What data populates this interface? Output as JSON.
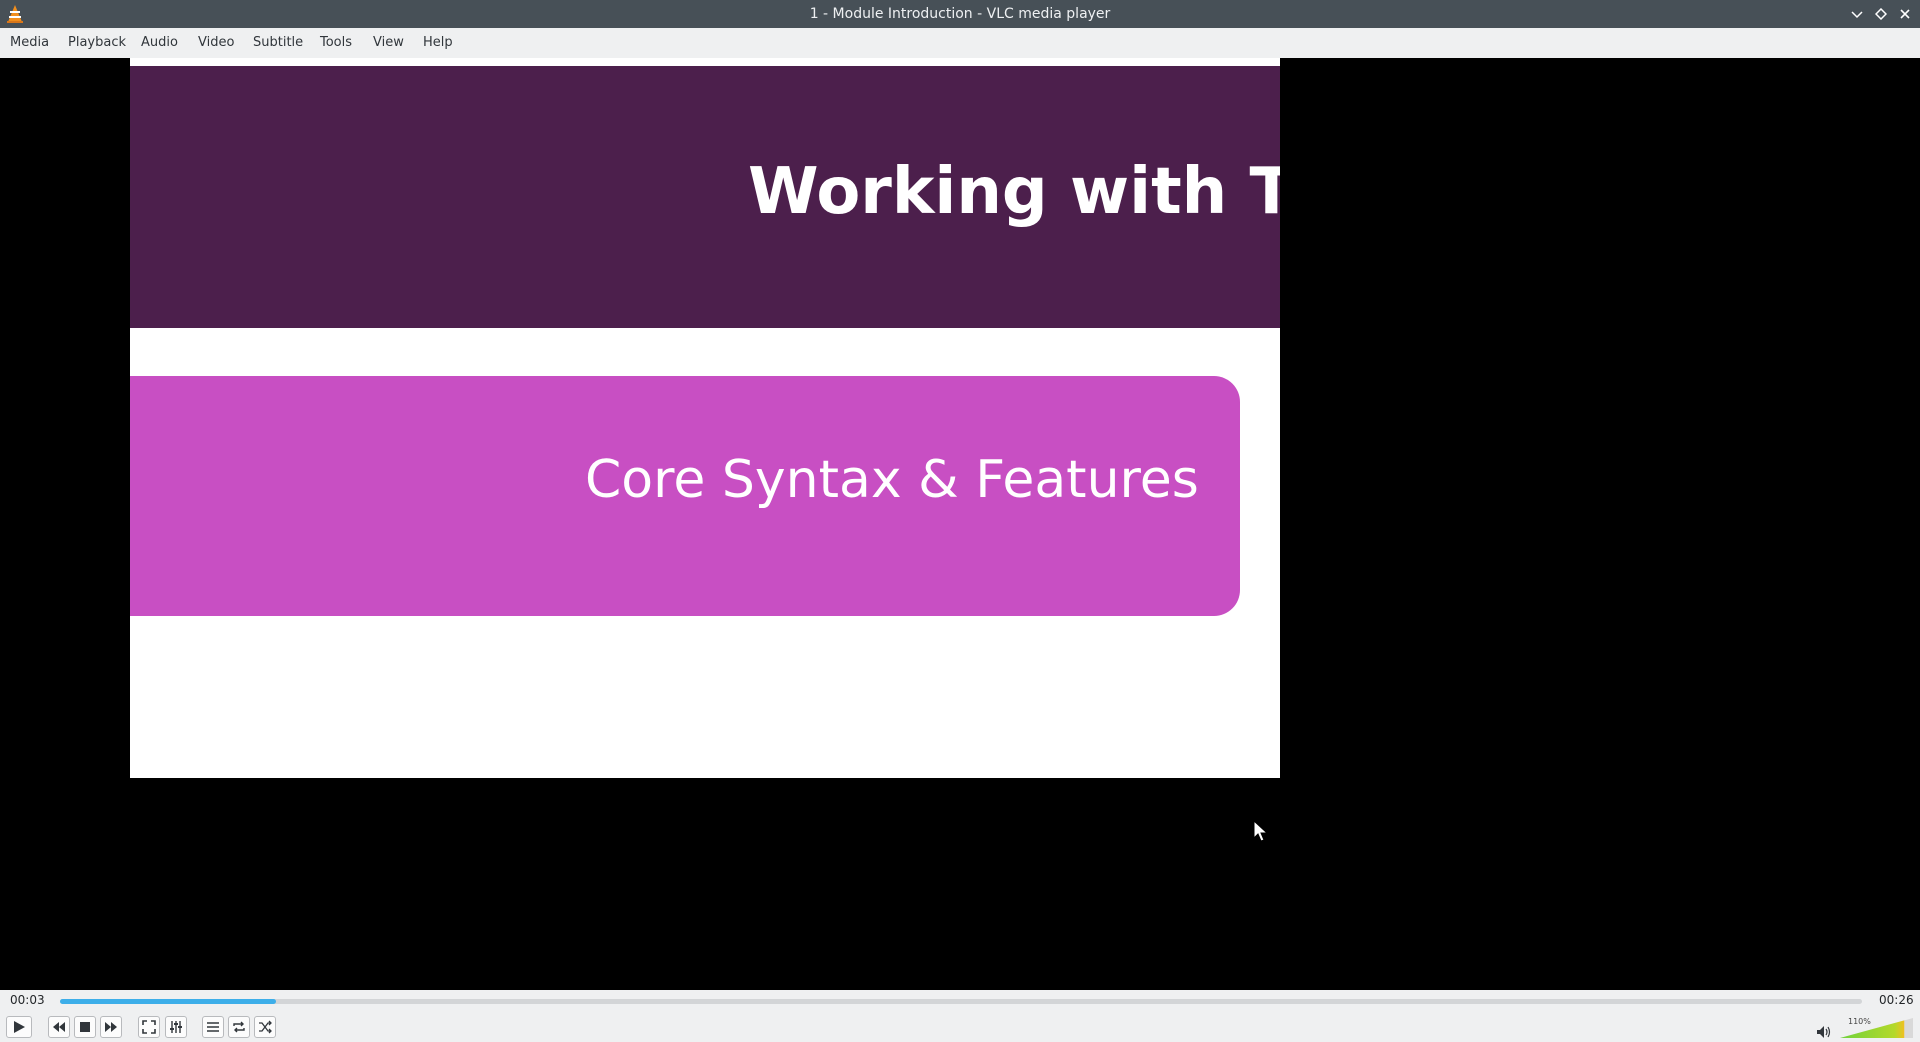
{
  "window": {
    "title": "1 - Module Introduction - VLC media player"
  },
  "menu": {
    "items": [
      "Media",
      "Playback",
      "Audio",
      "Video",
      "Subtitle",
      "Tools",
      "View",
      "Help"
    ]
  },
  "video": {
    "banner_title": "Working with Ty",
    "pill_text": "Core Syntax & Features"
  },
  "playback": {
    "elapsed": "00:03",
    "total": "00:26",
    "progress_fraction": 0.12
  },
  "volume": {
    "label": "110%",
    "level_percent": 110
  },
  "colors": {
    "titlebar": "#475057",
    "seek_fill": "#3daee9",
    "banner": "#4c1f4c",
    "pill": "#c84fc3"
  },
  "icons": [
    "vlc-cone-icon",
    "minimize-icon",
    "maximize-icon",
    "close-icon",
    "play-icon",
    "previous-icon",
    "stop-icon",
    "next-icon",
    "fullscreen-icon",
    "extended-settings-icon",
    "playlist-icon",
    "loop-icon",
    "shuffle-icon",
    "speaker-icon"
  ]
}
